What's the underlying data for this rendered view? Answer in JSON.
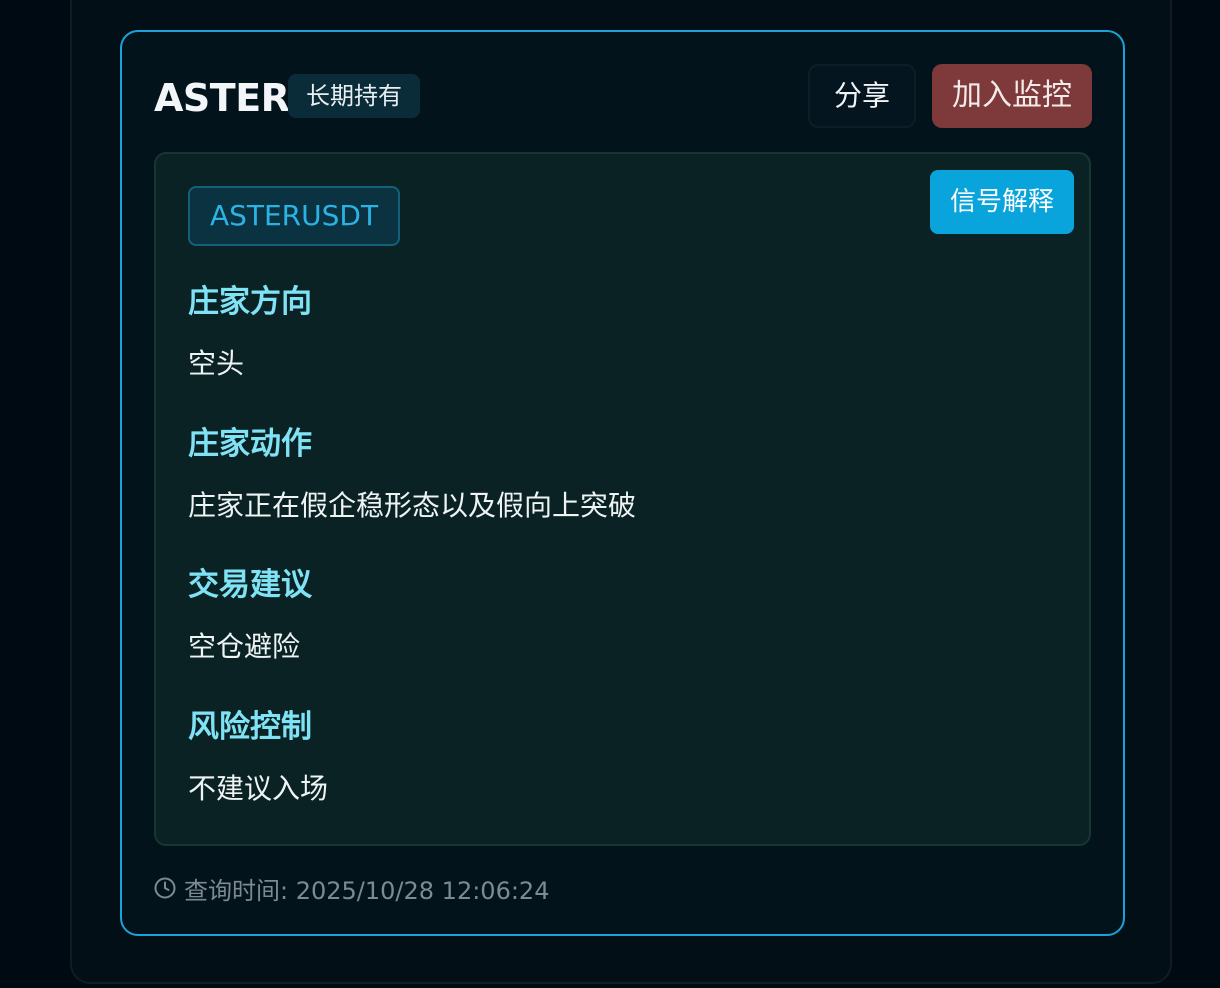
{
  "card": {
    "symbol": "ASTER",
    "badge": "长期持有",
    "share_label": "分享",
    "monitor_label": "加入监控",
    "pair": "ASTERUSDT",
    "explain_label": "信号解释",
    "sections": [
      {
        "heading": "庄家方向",
        "value": "空头"
      },
      {
        "heading": "庄家动作",
        "value": "庄家正在假企稳形态以及假向上突破"
      },
      {
        "heading": "交易建议",
        "value": "空仓避险"
      },
      {
        "heading": "风险控制",
        "value": "不建议入场"
      }
    ],
    "query_time": "查询时间: 2025/10/28 12:06:24",
    "clock_icon": "clock-icon"
  },
  "colors": {
    "accent": "#1aa3d8",
    "monitor_button": "#7e3a3a",
    "heading": "#7fe3f5",
    "explain_button": "#09a4dc"
  }
}
